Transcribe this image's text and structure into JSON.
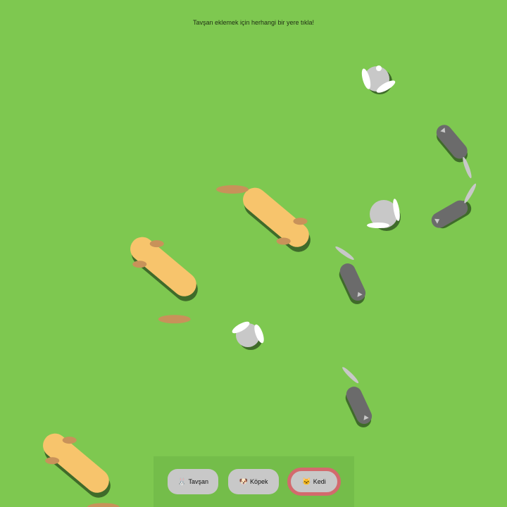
{
  "hint": "Tavşan eklemek için herhangi bir yere tıkla!",
  "toolbar": {
    "buttons": [
      {
        "name": "tavsan",
        "icon": "rabbit-face-icon",
        "glyph": "🐰",
        "label": "Tavşan",
        "selected": false
      },
      {
        "name": "kopek",
        "icon": "dog-face-icon",
        "glyph": "🐶",
        "label": "Köpek",
        "selected": false
      },
      {
        "name": "kedi",
        "icon": "cat-face-icon",
        "glyph": "🐱",
        "label": "Kedi",
        "selected": true
      }
    ]
  },
  "colors": {
    "grass": "#7ec850",
    "dog_body": "#f7c46c",
    "dog_ear": "#c8925a",
    "cat_body": "#6b6b6b",
    "cat_tail": "#c8c8c8",
    "rabbit_body": "#c8c8c8",
    "rabbit_ear": "#ffffff",
    "shadow": "#3f6b2a",
    "selected_ring": "#d36a6d"
  }
}
